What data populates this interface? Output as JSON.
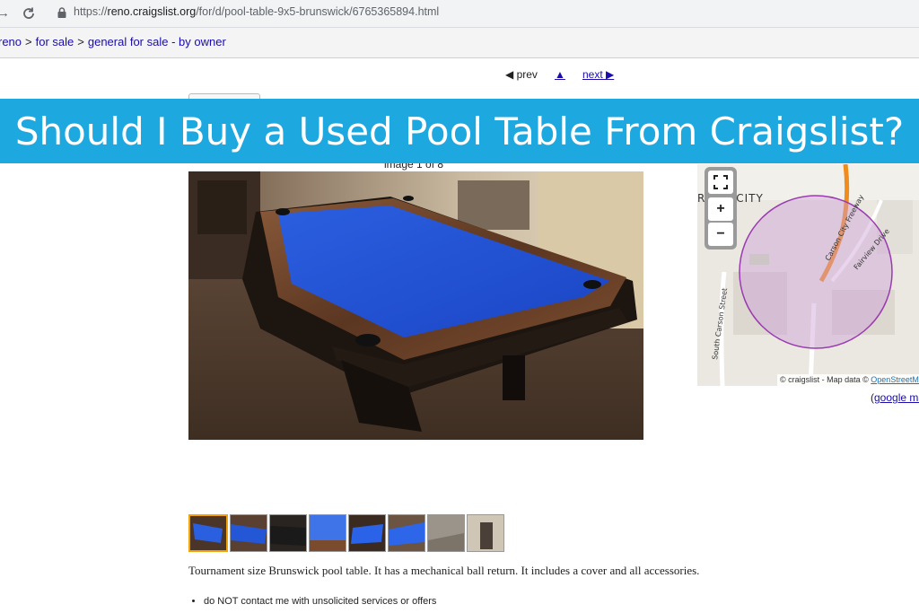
{
  "browser": {
    "url_prefix": "https://",
    "url_host": "reno.craigslist.org",
    "url_path": "/for/d/pool-table-9x5-brunswick/6765365894.html"
  },
  "breadcrumb": {
    "items": [
      "reno",
      "for sale",
      "general for sale - by owner"
    ],
    "separator": ">"
  },
  "post_nav": {
    "prev_label": "◀ prev",
    "up_label": "▲",
    "next_label": "next ▶"
  },
  "banner": {
    "title": "Should I Buy a Used Pool Table From Craigslist?",
    "color": "#1ea8e0"
  },
  "gallery": {
    "counter": "image 1 of 8",
    "thumbnail_count": 8
  },
  "map": {
    "city_label": "RSON CITY",
    "road_freeway": "Carson City Freeway",
    "road_fairview": "Fairview Drive",
    "road_carson": "South Carson Street",
    "zoom_in": "+",
    "zoom_out": "−",
    "attribution_prefix": "© craigslist - Map data © ",
    "attribution_link": "OpenStreetMap",
    "google_map_prefix": "(",
    "google_map_link": "google map"
  },
  "posting": {
    "description": "Tournament size Brunswick pool table. It has a mechanical ball return. It includes a cover and all accessories.",
    "notices": [
      "do NOT contact me with unsolicited services or offers"
    ]
  },
  "icons": [
    "back-arrow-icon",
    "reload-icon",
    "lock-icon",
    "fullscreen-icon"
  ]
}
